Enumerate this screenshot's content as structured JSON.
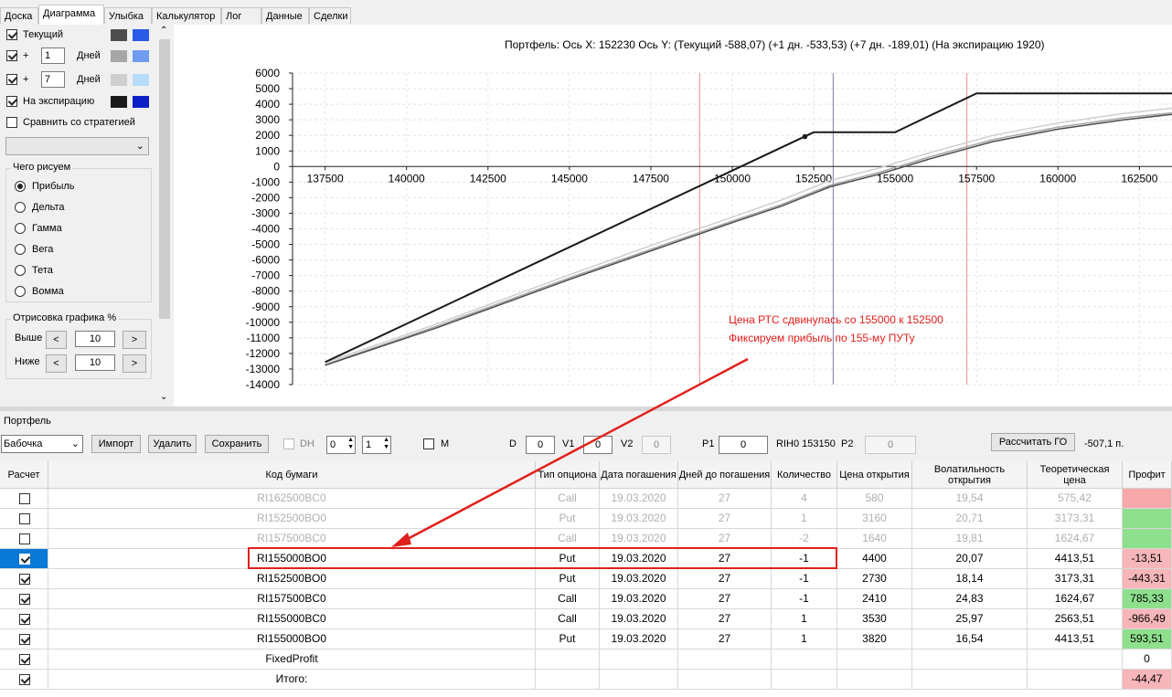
{
  "tabs": [
    "Доска",
    "Диаграмма",
    "Улыбка",
    "Калькулятор",
    "Лог",
    "Данные",
    "Сделки"
  ],
  "left": {
    "current_label": "Текущий",
    "plus1_sign": "+",
    "plus1_value": "1",
    "plus1_unit": "Дней",
    "plus2_sign": "+",
    "plus2_value": "7",
    "plus2_unit": "Дней",
    "expiration_label": "На экспирацию",
    "compare_label": "Сравнить со стратегией",
    "draw_group_title": "Чего рисуем",
    "draw_options": [
      "Прибыль",
      "Дельта",
      "Гамма",
      "Вега",
      "Тета",
      "Вомма"
    ],
    "render_group_title": "Отрисовка графика %",
    "above_label": "Выше",
    "above_value": "10",
    "below_label": "Ниже",
    "below_value": "10",
    "dec_glyph": "<",
    "inc_glyph": ">",
    "swatch_colors": {
      "current": [
        "#4d4d4d",
        "#2b59e8"
      ],
      "plus1": [
        "#a6a6a6",
        "#6f9cf0"
      ],
      "plus2": [
        "#cfcfcf",
        "#b8dcfb"
      ],
      "expiration": [
        "#1a1a1a",
        "#0b1fc7"
      ]
    }
  },
  "chart": {
    "header": "Портфель: Ось X:  152230 Ось Y:   (Текущий -588,07)   (+1 дн. -533,53)   (+7 дн. -189,01)   (На экспирацию 1920)",
    "annotation_line1": "Цена РТС сдвинулась со 155000 к 152500",
    "annotation_line2": "Фиксируем прибыль по 155-му ПУТу",
    "annotation_color": "#e0201c"
  },
  "chart_data": {
    "type": "line",
    "xlim": [
      136500,
      163500
    ],
    "ylim": [
      -14000,
      6000
    ],
    "x_ticks": [
      137500,
      140000,
      142500,
      145000,
      147500,
      150000,
      152500,
      155000,
      157500,
      160000,
      162500
    ],
    "y_ticks": [
      6000,
      5000,
      4000,
      3000,
      2000,
      1000,
      0,
      -1000,
      -2000,
      -3000,
      -4000,
      -5000,
      -6000,
      -7000,
      -8000,
      -9000,
      -10000,
      -11000,
      -12000,
      -13000,
      -14000
    ],
    "vertical_lines": [
      {
        "x": 149000,
        "color": "#f4a0a0"
      },
      {
        "x": 153100,
        "color": "#8b8fb5"
      },
      {
        "x": 157200,
        "color": "#f4a0a0"
      }
    ],
    "marker": {
      "x": 152230,
      "y": 1920
    },
    "series": [
      {
        "color": "#1a1a1a",
        "points": [
          [
            137500,
            -12560
          ],
          [
            152500,
            2200
          ],
          [
            155000,
            2200
          ],
          [
            157500,
            4700
          ],
          [
            163500,
            4700
          ]
        ]
      },
      {
        "color": "#4d4d4d",
        "points": [
          [
            137500,
            -12760
          ],
          [
            141000,
            -10300
          ],
          [
            145000,
            -7250
          ],
          [
            148000,
            -5050
          ],
          [
            150000,
            -3600
          ],
          [
            151500,
            -2550
          ],
          [
            153000,
            -1300
          ],
          [
            154500,
            -500
          ],
          [
            156000,
            450
          ],
          [
            158000,
            1600
          ],
          [
            160000,
            2400
          ],
          [
            162000,
            3000
          ],
          [
            163500,
            3350
          ]
        ]
      },
      {
        "color": "#a6a6a6",
        "points": [
          [
            137500,
            -12720
          ],
          [
            141000,
            -10200
          ],
          [
            145000,
            -7150
          ],
          [
            148000,
            -4950
          ],
          [
            150000,
            -3500
          ],
          [
            151500,
            -2450
          ],
          [
            153000,
            -1200
          ],
          [
            154500,
            -380
          ],
          [
            156000,
            580
          ],
          [
            158000,
            1730
          ],
          [
            160000,
            2530
          ],
          [
            162000,
            3120
          ],
          [
            163500,
            3450
          ]
        ]
      },
      {
        "color": "#cfcfcf",
        "points": [
          [
            137500,
            -12600
          ],
          [
            141000,
            -10050
          ],
          [
            145000,
            -6950
          ],
          [
            148000,
            -4700
          ],
          [
            150000,
            -3250
          ],
          [
            151500,
            -2150
          ],
          [
            153000,
            -900
          ],
          [
            154500,
            -100
          ],
          [
            156000,
            850
          ],
          [
            158000,
            2000
          ],
          [
            160000,
            2800
          ],
          [
            162000,
            3400
          ],
          [
            163500,
            3750
          ]
        ]
      }
    ]
  },
  "portfolio": {
    "title": "Портфель",
    "strategy": "Бабочка",
    "import_label": "Импорт",
    "delete_label": "Удалить",
    "save_label": "Сохранить",
    "dh_label": "DH",
    "spin1": "0",
    "spin2": "1",
    "m_label": "M",
    "d_label": "D",
    "d_value": "0",
    "v1_label": "V1",
    "v1_value": "0",
    "v2_label": "V2",
    "v2_value": "0",
    "p1_label": "P1",
    "p1_value": "0",
    "rih_label": "RIH0 153150",
    "p2_label": "P2",
    "p2_value": "0",
    "calc_go_label": "Рассчитать ГО",
    "go_value": "-507,1 п."
  },
  "table": {
    "headers": [
      "Расчет",
      "Код бумаги",
      "Тип опциона",
      "Дата погашения",
      "Дней до погашения",
      "Количество",
      "Цена открытия",
      "Волатильность открытия",
      "Теоретическая цена",
      "Профит"
    ],
    "rows": [
      {
        "checked": false,
        "code": "RI162500BC0",
        "type": "Call",
        "date": "19.03.2020",
        "days": "27",
        "qty": "4",
        "price": "580",
        "vol": "19,54",
        "theo": "575,42",
        "profit": "",
        "bg": "#f7a8ab",
        "dim": true
      },
      {
        "checked": false,
        "code": "RI152500BO0",
        "type": "Put",
        "date": "19.03.2020",
        "days": "27",
        "qty": "1",
        "price": "3160",
        "vol": "20,71",
        "theo": "3173,31",
        "profit": "",
        "bg": "#8fe08d",
        "dim": true
      },
      {
        "checked": false,
        "code": "RI157500BC0",
        "type": "Call",
        "date": "19.03.2020",
        "days": "27",
        "qty": "-2",
        "price": "1640",
        "vol": "19,81",
        "theo": "1624,67",
        "profit": "",
        "bg": "#8fe08d",
        "dim": true
      },
      {
        "checked": true,
        "selected": true,
        "code": "RI155000BO0",
        "type": "Put",
        "date": "19.03.2020",
        "days": "27",
        "qty": "-1",
        "price": "4400",
        "vol": "20,07",
        "theo": "4413,51",
        "profit": "-13,51",
        "bg": "#f7b6b9",
        "dim": false
      },
      {
        "checked": true,
        "code": "RI152500BO0",
        "type": "Put",
        "date": "19.03.2020",
        "days": "27",
        "qty": "-1",
        "price": "2730",
        "vol": "18,14",
        "theo": "3173,31",
        "profit": "-443,31",
        "bg": "#f7b6b9",
        "dim": false
      },
      {
        "checked": true,
        "code": "RI157500BC0",
        "type": "Call",
        "date": "19.03.2020",
        "days": "27",
        "qty": "-1",
        "price": "2410",
        "vol": "24,83",
        "theo": "1624,67",
        "profit": "785,33",
        "bg": "#8fe08d",
        "dim": false
      },
      {
        "checked": true,
        "code": "RI155000BC0",
        "type": "Call",
        "date": "19.03.2020",
        "days": "27",
        "qty": "1",
        "price": "3530",
        "vol": "25,97",
        "theo": "2563,51",
        "profit": "-966,49",
        "bg": "#f7b6b9",
        "dim": false
      },
      {
        "checked": true,
        "code": "RI155000BO0",
        "type": "Put",
        "date": "19.03.2020",
        "days": "27",
        "qty": "1",
        "price": "3820",
        "vol": "16,54",
        "theo": "4413,51",
        "profit": "593,51",
        "bg": "#8fe08d",
        "dim": false
      },
      {
        "checked": true,
        "code": "FixedProfit",
        "type": "",
        "date": "",
        "days": "",
        "qty": "",
        "price": "",
        "vol": "",
        "theo": "",
        "profit": "0",
        "bg": "#ffffff",
        "dim": false
      },
      {
        "checked": true,
        "code": "Итого:",
        "type": "",
        "date": "",
        "days": "",
        "qty": "",
        "price": "",
        "vol": "",
        "theo": "",
        "profit": "-44,47",
        "bg": "#f7b6b9",
        "dim": false
      }
    ]
  }
}
